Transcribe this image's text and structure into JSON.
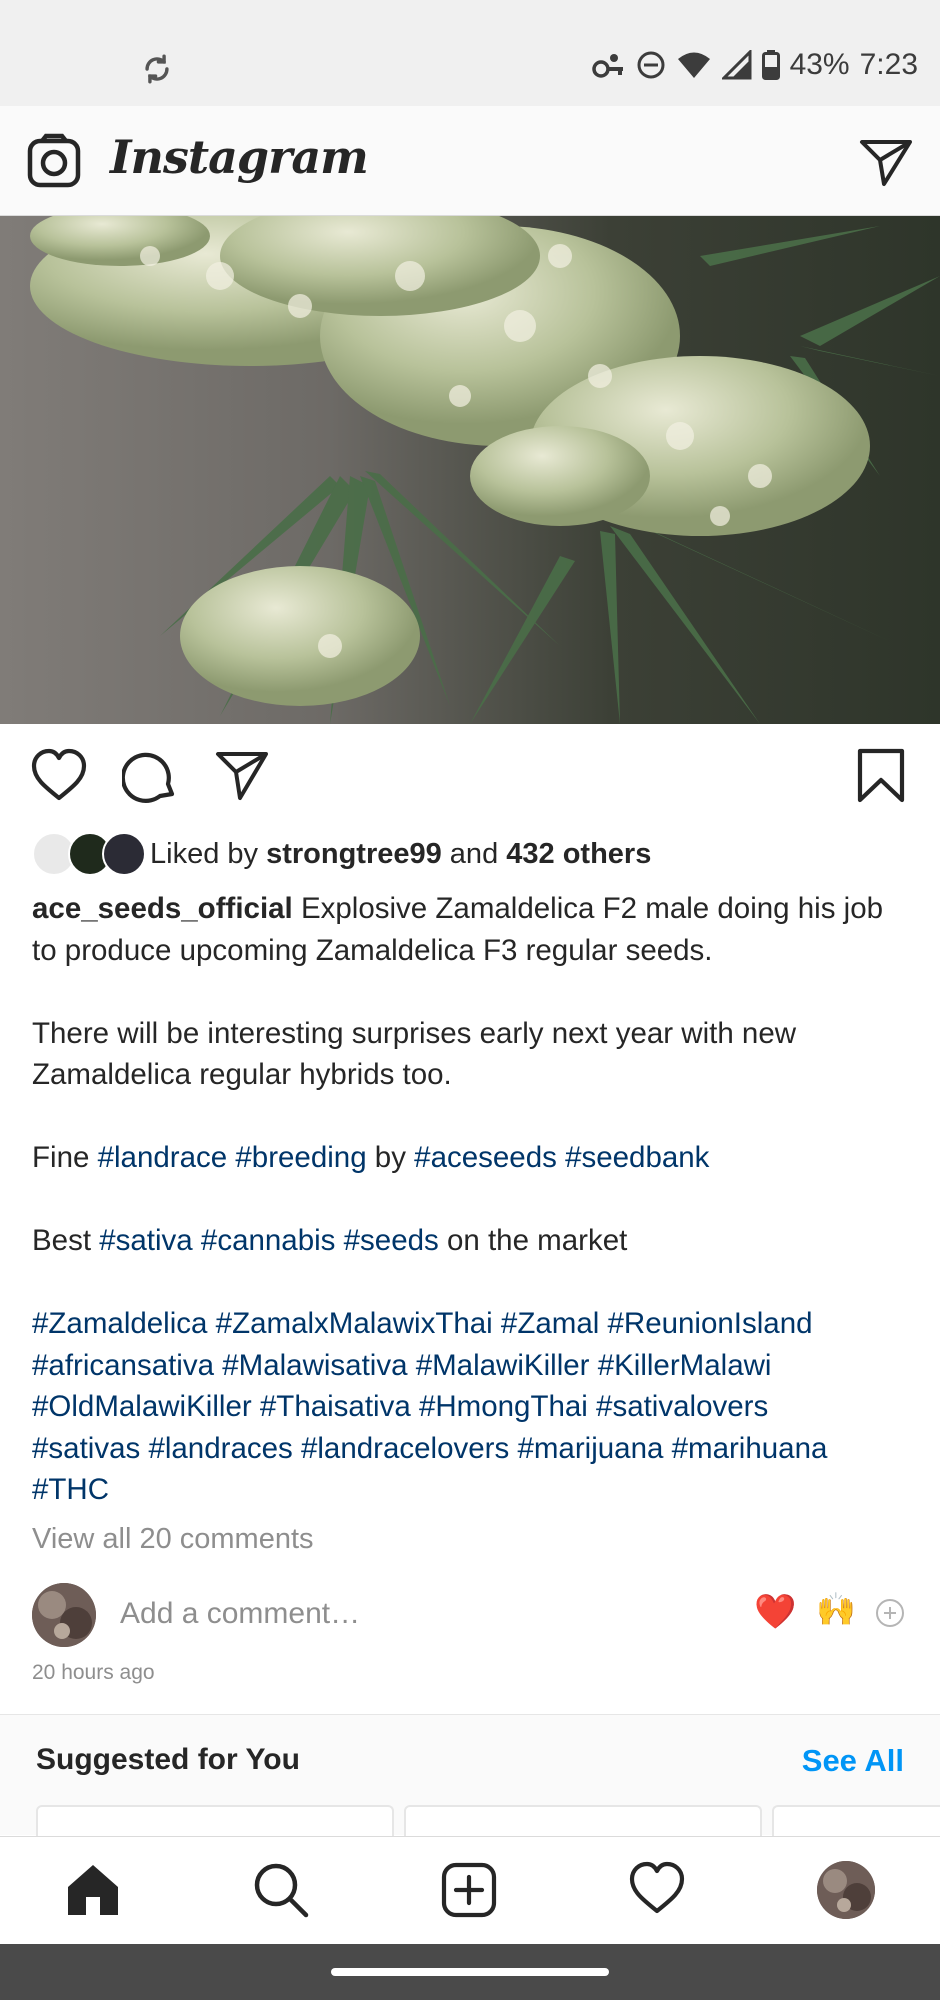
{
  "status_bar": {
    "battery_percent": "43%",
    "time": "7:23",
    "icons": [
      "sync-icon",
      "key-icon",
      "do-not-disturb-icon",
      "wifi-icon",
      "signal-icon",
      "battery-icon"
    ]
  },
  "header": {
    "brand": "Instagram",
    "icons": [
      "camera-icon",
      "direct-message-icon"
    ]
  },
  "post": {
    "likes": {
      "prefix": "Liked by ",
      "user": "strongtree99",
      "middle": " and ",
      "others": "432 others"
    },
    "caption": {
      "username": "ace_seeds_official",
      "line1": " Explosive Zamaldelica F2 male doing his job to produce upcoming Zamaldelica F3 regular seeds.",
      "line2": "There will be interesting surprises early next year with new Zamaldelica regular hybrids too.",
      "fine_prefix": "Fine ",
      "fine_tags1": [
        "#landrace",
        "#breeding"
      ],
      "fine_by": " by ",
      "fine_tags2": [
        "#aceseeds",
        "#seedbank"
      ],
      "best_prefix": "Best ",
      "best_tags": [
        "#sativa",
        "#cannabis",
        "#seeds"
      ],
      "best_suffix": " on the market",
      "hashtags": [
        "#Zamaldelica",
        "#ZamalxMalawixThai",
        "#Zamal",
        "#ReunionIsland",
        "#africansativa",
        "#Malawisativa",
        "#MalawiKiller",
        "#KillerMalawi",
        "#OldMalawiKiller",
        "#Thaisativa",
        "#HmongThai",
        "#sativalovers",
        "#sativas",
        "#landraces",
        "#landracelovers",
        "#marijuana",
        "#marihuana",
        "#THC"
      ]
    },
    "view_comments": "View all 20 comments",
    "comment_placeholder": "Add a comment…",
    "quick_reactions": [
      "❤️",
      "🙌"
    ],
    "timestamp": "20 hours ago"
  },
  "suggested": {
    "title": "Suggested for You",
    "see_all": "See All"
  },
  "bottom_nav": [
    "home-icon",
    "search-icon",
    "add-post-icon",
    "activity-icon",
    "profile-avatar"
  ],
  "colors": {
    "hashtag": "#003569",
    "link_blue": "#0095f6",
    "muted": "#8e8e8e",
    "heart_red": "#e0151f"
  }
}
